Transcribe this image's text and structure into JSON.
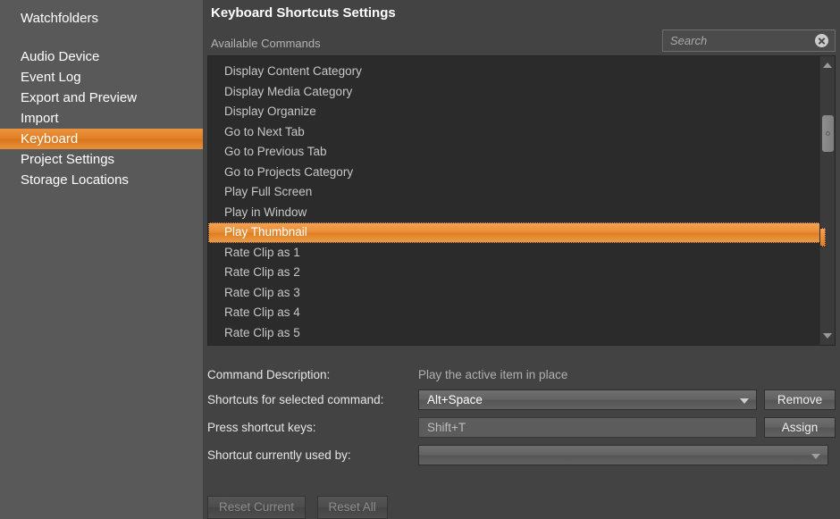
{
  "sidebar": {
    "top_item": "Watchfolders",
    "items": [
      {
        "label": "Audio Device",
        "selected": false
      },
      {
        "label": "Event Log",
        "selected": false
      },
      {
        "label": "Export and Preview",
        "selected": false
      },
      {
        "label": "Import",
        "selected": false
      },
      {
        "label": "Keyboard",
        "selected": true
      },
      {
        "label": "Project Settings",
        "selected": false
      },
      {
        "label": "Storage Locations",
        "selected": false
      }
    ]
  },
  "panel": {
    "title": "Keyboard Shortcuts Settings",
    "available_commands_label": "Available Commands"
  },
  "search": {
    "value": "",
    "placeholder": "Search",
    "clear_icon": "clear-circle-icon"
  },
  "command_list": {
    "items": [
      {
        "label": "Display Content Category",
        "selected": false
      },
      {
        "label": "Display Media Category",
        "selected": false
      },
      {
        "label": "Display Organize",
        "selected": false
      },
      {
        "label": "Go to Next Tab",
        "selected": false
      },
      {
        "label": "Go to Previous Tab",
        "selected": false
      },
      {
        "label": "Go to Projects Category",
        "selected": false
      },
      {
        "label": "Play Full Screen",
        "selected": false
      },
      {
        "label": "Play in Window",
        "selected": false
      },
      {
        "label": "Play Thumbnail",
        "selected": true
      },
      {
        "label": "Rate Clip as 1",
        "selected": false
      },
      {
        "label": "Rate Clip as 2",
        "selected": false
      },
      {
        "label": "Rate Clip as 3",
        "selected": false
      },
      {
        "label": "Rate Clip as 4",
        "selected": false
      },
      {
        "label": "Rate Clip as 5",
        "selected": false
      }
    ],
    "scrollbar": {
      "up_arrow_icon": "scroll-up-arrow-icon",
      "down_arrow_icon": "scroll-down-arrow-icon",
      "thumb_icon": "scrollbar-thumb"
    }
  },
  "form": {
    "command_description_label": "Command Description:",
    "command_description_value": "Play the active item in place",
    "shortcuts_label": "Shortcuts for selected command:",
    "shortcuts_value": "Alt+Space",
    "press_keys_label": "Press shortcut keys:",
    "press_keys_value": "Shift+T",
    "press_keys_placeholder": "",
    "used_by_label": "Shortcut currently used by:",
    "used_by_value": "",
    "remove_button": "Remove",
    "assign_button": "Assign",
    "reset_current_button": "Reset Current",
    "reset_all_button": "Reset All"
  },
  "colors": {
    "accent_orange": "#e88c33",
    "sidebar_bg": "#595959",
    "panel_bg": "#434343",
    "list_bg": "#2b2b2b"
  }
}
